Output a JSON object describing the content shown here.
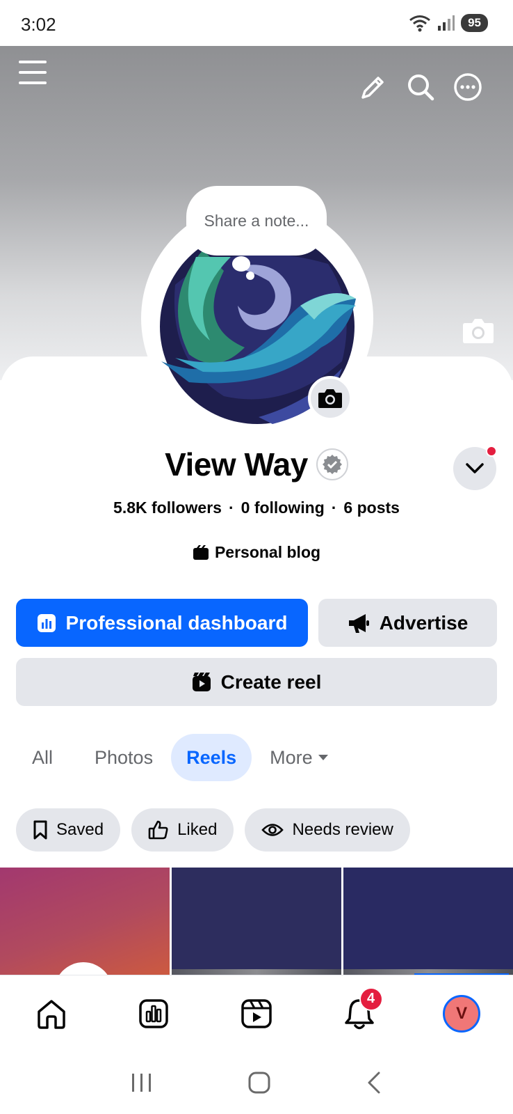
{
  "status_bar": {
    "time": "3:02",
    "battery": "95"
  },
  "cover": {
    "icons": [
      "menu-icon",
      "pencil-icon",
      "search-icon",
      "more-icon",
      "camera-icon"
    ]
  },
  "note": {
    "placeholder": "Share a note..."
  },
  "profile": {
    "name": "View Way",
    "verified": true,
    "followers": "5.8K followers",
    "following": "0 following",
    "posts": "6 posts",
    "separator": "·",
    "category": "Personal blog"
  },
  "actions": {
    "dashboard_label": "Professional dashboard",
    "advertise_label": "Advertise",
    "create_reel_label": "Create reel"
  },
  "tabs": [
    {
      "label": "All",
      "active": false
    },
    {
      "label": "Photos",
      "active": false
    },
    {
      "label": "Reels",
      "active": true
    },
    {
      "label": "More",
      "active": false
    }
  ],
  "chips": [
    {
      "label": "Saved",
      "icon": "bookmark-icon"
    },
    {
      "label": "Liked",
      "icon": "thumbs-up-icon"
    },
    {
      "label": "Needs review",
      "icon": "eye-icon"
    }
  ],
  "bottom_nav": {
    "items": [
      "home-icon",
      "dashboard-icon",
      "reels-icon",
      "notifications-icon",
      "profile-avatar"
    ],
    "notification_count": "4",
    "avatar_letter": "V"
  },
  "colors": {
    "primary": "#0866ff",
    "badge": "#e41e3f",
    "chip_bg": "#e4e6eb"
  }
}
